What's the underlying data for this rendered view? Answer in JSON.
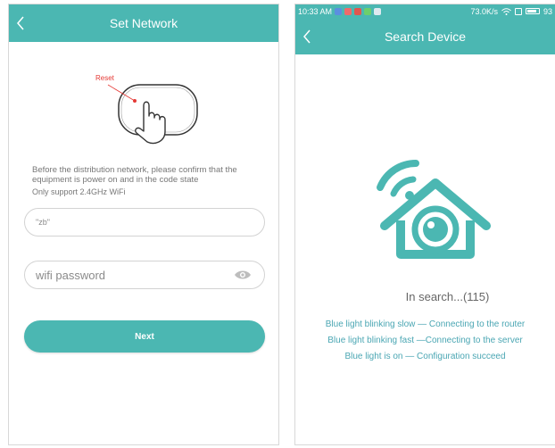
{
  "colors": {
    "accent": "#4bb7b2",
    "reset_red": "#e53935",
    "legend_blue": "#4aa6b3"
  },
  "left_screen": {
    "title": "Set Network",
    "back_icon": "chevron-left-icon",
    "reset_label": "Reset",
    "instructions": "Before the distribution network, please confirm that the equipment is power on and in the code state",
    "wifi_note": "Only support 2.4GHz WiFi",
    "ssid_value": "\"zb\"",
    "password_placeholder": "wifi password",
    "eye_icon": "eye-icon",
    "next_label": "Next"
  },
  "right_screen": {
    "status_bar": {
      "time": "10:33 AM",
      "speed": "73.0K/s",
      "battery": "93"
    },
    "title": "Search Device",
    "back_icon": "chevron-left-icon",
    "device_icon": "camera-house-icon",
    "search_status": "In search...(115)",
    "legend": [
      "Blue light blinking slow — Connecting to the router",
      "Blue light blinking fast —Connecting to the server",
      "Blue light is on — Configuration succeed"
    ]
  }
}
